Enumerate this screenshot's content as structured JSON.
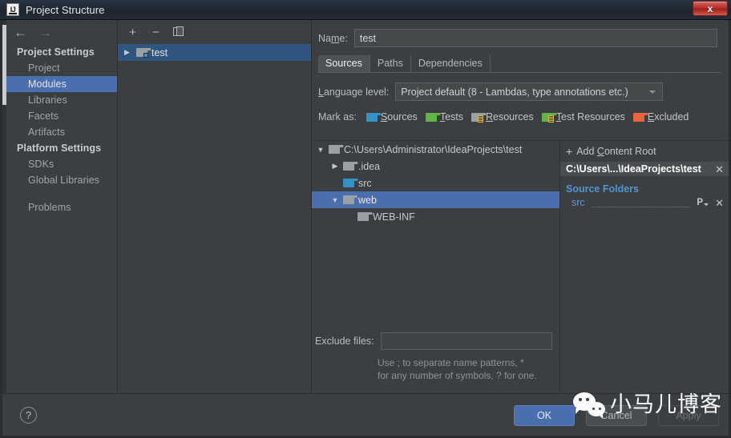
{
  "window": {
    "title": "Project Structure",
    "app_icon": "intellij-idea-icon",
    "close_label": "x"
  },
  "nav": {
    "back_icon": "←",
    "forward_icon": "→"
  },
  "sidebar": {
    "groups": [
      {
        "label": "Project Settings",
        "items": [
          {
            "label": "Project",
            "selected": false
          },
          {
            "label": "Modules",
            "selected": true
          },
          {
            "label": "Libraries",
            "selected": false
          },
          {
            "label": "Facets",
            "selected": false
          },
          {
            "label": "Artifacts",
            "selected": false
          }
        ]
      },
      {
        "label": "Platform Settings",
        "items": [
          {
            "label": "SDKs",
            "selected": false
          },
          {
            "label": "Global Libraries",
            "selected": false
          }
        ]
      }
    ],
    "extra": [
      {
        "label": "Problems"
      }
    ]
  },
  "modules_panel": {
    "toolbar": {
      "add_label": "+",
      "remove_label": "−",
      "copy_label": "copy-icon"
    },
    "items": [
      {
        "label": "test",
        "expand_icon": "▶",
        "selected": true,
        "icon": "module-folder-icon"
      }
    ]
  },
  "details": {
    "name_label": "Name:",
    "name_label_pre": "Na",
    "name_label_key": "m",
    "name_label_post": "e:",
    "name_value": "test",
    "tabs": [
      {
        "label": "Sources",
        "active": true
      },
      {
        "label": "Paths",
        "active": false
      },
      {
        "label": "Dependencies",
        "active": false
      }
    ],
    "language_level_label": "Language level:",
    "language_level_key": "L",
    "language_level_rest": "anguage level:",
    "language_level_value": "Project default (8 - Lambdas, type annotations etc.)",
    "mark_as_label": "Mark as:",
    "mark_as": [
      {
        "label": "Sources",
        "key": "S",
        "rest": "ources",
        "icon": "folder-blue-icon"
      },
      {
        "label": "Tests",
        "key": "T",
        "rest": "ests",
        "icon": "folder-green-icon"
      },
      {
        "label": "Resources",
        "key": "R",
        "rest": "esources",
        "icon": "folder-resources-icon"
      },
      {
        "label": "Test Resources",
        "key": "T",
        "rest": "est Resources",
        "icon": "folder-test-resources-icon"
      },
      {
        "label": "Excluded",
        "key": "E",
        "rest": "xcluded",
        "icon": "folder-orange-icon"
      }
    ]
  },
  "tree": [
    {
      "label": "C:\\Users\\Administrator\\IdeaProjects\\test",
      "indent": 0,
      "arrow": "▼",
      "icon": "folder-gray-icon",
      "selected": false
    },
    {
      "label": ".idea",
      "indent": 1,
      "arrow": "▶",
      "icon": "folder-gray-icon",
      "selected": false
    },
    {
      "label": "src",
      "indent": 1,
      "arrow": "",
      "icon": "folder-blue-icon",
      "selected": false
    },
    {
      "label": "web",
      "indent": 1,
      "arrow": "▼",
      "icon": "folder-gray-icon",
      "selected": true
    },
    {
      "label": "WEB-INF",
      "indent": 2,
      "arrow": "",
      "icon": "folder-gray-icon",
      "selected": false
    }
  ],
  "content_roots": {
    "add_label": "Add Content Root",
    "add_key": "C",
    "add_pre": "Add ",
    "add_post": "ontent Root",
    "plus_icon": "+",
    "root_path": "C:\\Users\\...\\IdeaProjects\\test",
    "remove_icon": "✕",
    "source_folders_title": "Source Folders",
    "source_folders": [
      {
        "name": "src",
        "package_prefix_icon": "P",
        "remove_icon": "✕"
      }
    ]
  },
  "exclude": {
    "label": "Exclude files:",
    "value": "",
    "hint_line1": "Use ; to separate name patterns, *",
    "hint_line2": "for any number of symbols, ? for one."
  },
  "footer": {
    "help_label": "?",
    "ok_label": "OK",
    "cancel_label": "Cancel",
    "apply_label": "Apply"
  },
  "watermark": {
    "text": "小马儿博客",
    "icon": "wechat-logo-icon"
  },
  "colors": {
    "selection_blue": "#4b6eaf",
    "module_selection": "#2f5580",
    "link_blue": "#5394d4",
    "source_folder_blue": "#6699cc",
    "panel_bg": "#3c3f41",
    "close_red": "#b8312a"
  }
}
